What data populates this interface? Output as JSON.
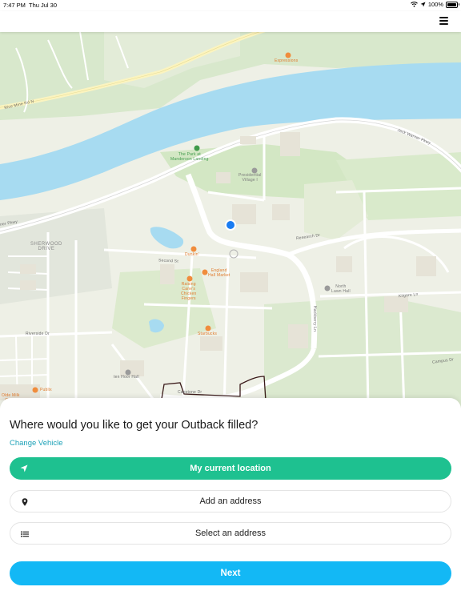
{
  "status_bar": {
    "time": "7:47 PM",
    "date": "Thu Jul 30",
    "battery": "100%",
    "icons": [
      "wifi-icon",
      "location-arrow-icon",
      "battery-icon"
    ]
  },
  "header": {
    "menu_icon": "hamburger-menu-icon"
  },
  "map": {
    "labels": {
      "expressions": "Expressions",
      "rice_mine": "Rice Mine Rd N",
      "jack_warner": "Jack Warner Pkwy",
      "park": "The Park at\nManderson Landing",
      "presidential": "Presidential\nVillage I",
      "warner_pkwy": "ner Pkwy",
      "sherwood": "SHERWOOD\nDRIVE",
      "dunkin": "Dunkin'",
      "england": "England\nHall Market",
      "raising": "Raising\nCane's\nChicken\nFingers",
      "second": "Second St",
      "research": "Research Dr",
      "north_lawn": "North\nLawn Hall",
      "campus": "Campus Dr",
      "hackberry": "Hackberry Ln",
      "starbucks": "Starbucks",
      "riverside": "Riverside Dr",
      "ten_hoor": "ten Hoor Hall",
      "publix": "Publix",
      "capstone": "Capstone Dr",
      "kilgore": "Kilgore Ln",
      "olde_milk": "Olde Milk\nCamp"
    }
  },
  "sheet": {
    "question": "Where would you like to get your Outback filled?",
    "change_vehicle": "Change Vehicle",
    "current_location": "My current location",
    "add_address": "Add an address",
    "select_address": "Select an address",
    "next": "Next"
  },
  "colors": {
    "primary_green": "#1ec190",
    "next_blue": "#13b8f5",
    "link_teal": "#1ea2b8",
    "water": "#a7dbf1",
    "park_green": "#d3e7c4",
    "user_dot": "#1a7cf2"
  }
}
